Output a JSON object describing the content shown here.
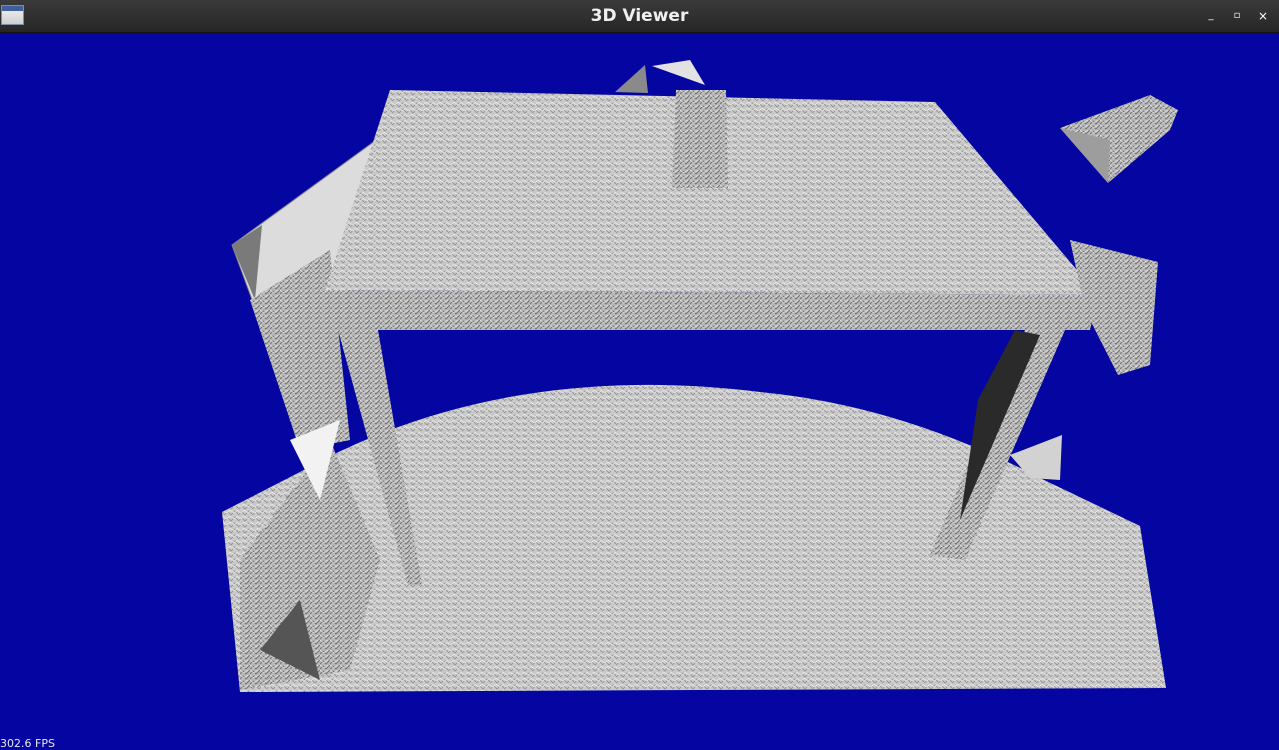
{
  "window": {
    "title": "3D Viewer",
    "app_icon": "window-app-icon",
    "controls": {
      "minimize_icon": "_",
      "maximize_icon": "▫",
      "close_icon": "×"
    }
  },
  "viewport": {
    "background_color": "#0505a2",
    "mesh_color": "#c8c8c8",
    "fps_label": "302.6 FPS"
  }
}
